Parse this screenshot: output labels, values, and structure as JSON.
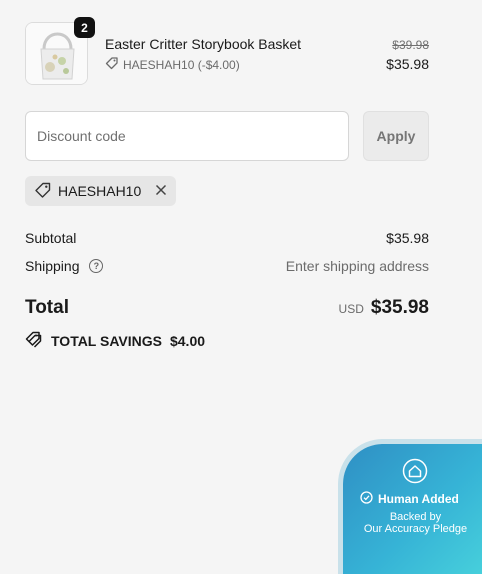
{
  "product": {
    "quantity": "2",
    "title": "Easter Critter Storybook Basket",
    "discount_line": "HAESHAH10 (-$4.00)",
    "original_price": "$39.98",
    "price": "$35.98"
  },
  "discount_form": {
    "placeholder": "Discount code",
    "apply_label": "Apply"
  },
  "applied_code": {
    "code": "HAESHAH10"
  },
  "summary": {
    "subtotal_label": "Subtotal",
    "subtotal_value": "$35.98",
    "shipping_label": "Shipping",
    "shipping_value": "Enter shipping address",
    "total_label": "Total",
    "currency": "USD",
    "total_value": "$35.98",
    "savings_label": "TOTAL SAVINGS",
    "savings_value": "$4.00"
  },
  "badge": {
    "title": "Human Added",
    "line1": "Backed by",
    "line2": "Our Accuracy Pledge"
  },
  "colors": {
    "badge_gradient_start": "#2f8fc4",
    "badge_gradient_end": "#48d2dc",
    "quantity_badge": "#111111"
  },
  "icons": [
    "tag-icon",
    "close-icon",
    "help-icon",
    "savings-tag-icon",
    "home-icon",
    "check-circle-icon"
  ]
}
